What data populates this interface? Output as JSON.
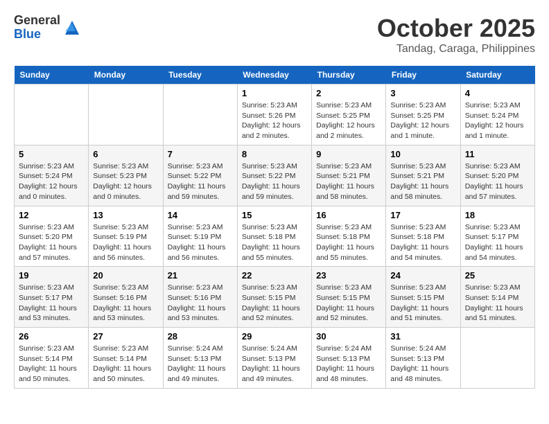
{
  "header": {
    "logo_line1": "General",
    "logo_line2": "Blue",
    "month": "October 2025",
    "location": "Tandag, Caraga, Philippines"
  },
  "weekdays": [
    "Sunday",
    "Monday",
    "Tuesday",
    "Wednesday",
    "Thursday",
    "Friday",
    "Saturday"
  ],
  "weeks": [
    [
      {
        "day": "",
        "info": ""
      },
      {
        "day": "",
        "info": ""
      },
      {
        "day": "",
        "info": ""
      },
      {
        "day": "1",
        "info": "Sunrise: 5:23 AM\nSunset: 5:26 PM\nDaylight: 12 hours and 2 minutes."
      },
      {
        "day": "2",
        "info": "Sunrise: 5:23 AM\nSunset: 5:25 PM\nDaylight: 12 hours and 2 minutes."
      },
      {
        "day": "3",
        "info": "Sunrise: 5:23 AM\nSunset: 5:25 PM\nDaylight: 12 hours and 1 minute."
      },
      {
        "day": "4",
        "info": "Sunrise: 5:23 AM\nSunset: 5:24 PM\nDaylight: 12 hours and 1 minute."
      }
    ],
    [
      {
        "day": "5",
        "info": "Sunrise: 5:23 AM\nSunset: 5:24 PM\nDaylight: 12 hours and 0 minutes."
      },
      {
        "day": "6",
        "info": "Sunrise: 5:23 AM\nSunset: 5:23 PM\nDaylight: 12 hours and 0 minutes."
      },
      {
        "day": "7",
        "info": "Sunrise: 5:23 AM\nSunset: 5:22 PM\nDaylight: 11 hours and 59 minutes."
      },
      {
        "day": "8",
        "info": "Sunrise: 5:23 AM\nSunset: 5:22 PM\nDaylight: 11 hours and 59 minutes."
      },
      {
        "day": "9",
        "info": "Sunrise: 5:23 AM\nSunset: 5:21 PM\nDaylight: 11 hours and 58 minutes."
      },
      {
        "day": "10",
        "info": "Sunrise: 5:23 AM\nSunset: 5:21 PM\nDaylight: 11 hours and 58 minutes."
      },
      {
        "day": "11",
        "info": "Sunrise: 5:23 AM\nSunset: 5:20 PM\nDaylight: 11 hours and 57 minutes."
      }
    ],
    [
      {
        "day": "12",
        "info": "Sunrise: 5:23 AM\nSunset: 5:20 PM\nDaylight: 11 hours and 57 minutes."
      },
      {
        "day": "13",
        "info": "Sunrise: 5:23 AM\nSunset: 5:19 PM\nDaylight: 11 hours and 56 minutes."
      },
      {
        "day": "14",
        "info": "Sunrise: 5:23 AM\nSunset: 5:19 PM\nDaylight: 11 hours and 56 minutes."
      },
      {
        "day": "15",
        "info": "Sunrise: 5:23 AM\nSunset: 5:18 PM\nDaylight: 11 hours and 55 minutes."
      },
      {
        "day": "16",
        "info": "Sunrise: 5:23 AM\nSunset: 5:18 PM\nDaylight: 11 hours and 55 minutes."
      },
      {
        "day": "17",
        "info": "Sunrise: 5:23 AM\nSunset: 5:18 PM\nDaylight: 11 hours and 54 minutes."
      },
      {
        "day": "18",
        "info": "Sunrise: 5:23 AM\nSunset: 5:17 PM\nDaylight: 11 hours and 54 minutes."
      }
    ],
    [
      {
        "day": "19",
        "info": "Sunrise: 5:23 AM\nSunset: 5:17 PM\nDaylight: 11 hours and 53 minutes."
      },
      {
        "day": "20",
        "info": "Sunrise: 5:23 AM\nSunset: 5:16 PM\nDaylight: 11 hours and 53 minutes."
      },
      {
        "day": "21",
        "info": "Sunrise: 5:23 AM\nSunset: 5:16 PM\nDaylight: 11 hours and 53 minutes."
      },
      {
        "day": "22",
        "info": "Sunrise: 5:23 AM\nSunset: 5:15 PM\nDaylight: 11 hours and 52 minutes."
      },
      {
        "day": "23",
        "info": "Sunrise: 5:23 AM\nSunset: 5:15 PM\nDaylight: 11 hours and 52 minutes."
      },
      {
        "day": "24",
        "info": "Sunrise: 5:23 AM\nSunset: 5:15 PM\nDaylight: 11 hours and 51 minutes."
      },
      {
        "day": "25",
        "info": "Sunrise: 5:23 AM\nSunset: 5:14 PM\nDaylight: 11 hours and 51 minutes."
      }
    ],
    [
      {
        "day": "26",
        "info": "Sunrise: 5:23 AM\nSunset: 5:14 PM\nDaylight: 11 hours and 50 minutes."
      },
      {
        "day": "27",
        "info": "Sunrise: 5:23 AM\nSunset: 5:14 PM\nDaylight: 11 hours and 50 minutes."
      },
      {
        "day": "28",
        "info": "Sunrise: 5:24 AM\nSunset: 5:13 PM\nDaylight: 11 hours and 49 minutes."
      },
      {
        "day": "29",
        "info": "Sunrise: 5:24 AM\nSunset: 5:13 PM\nDaylight: 11 hours and 49 minutes."
      },
      {
        "day": "30",
        "info": "Sunrise: 5:24 AM\nSunset: 5:13 PM\nDaylight: 11 hours and 48 minutes."
      },
      {
        "day": "31",
        "info": "Sunrise: 5:24 AM\nSunset: 5:13 PM\nDaylight: 11 hours and 48 minutes."
      },
      {
        "day": "",
        "info": ""
      }
    ]
  ]
}
